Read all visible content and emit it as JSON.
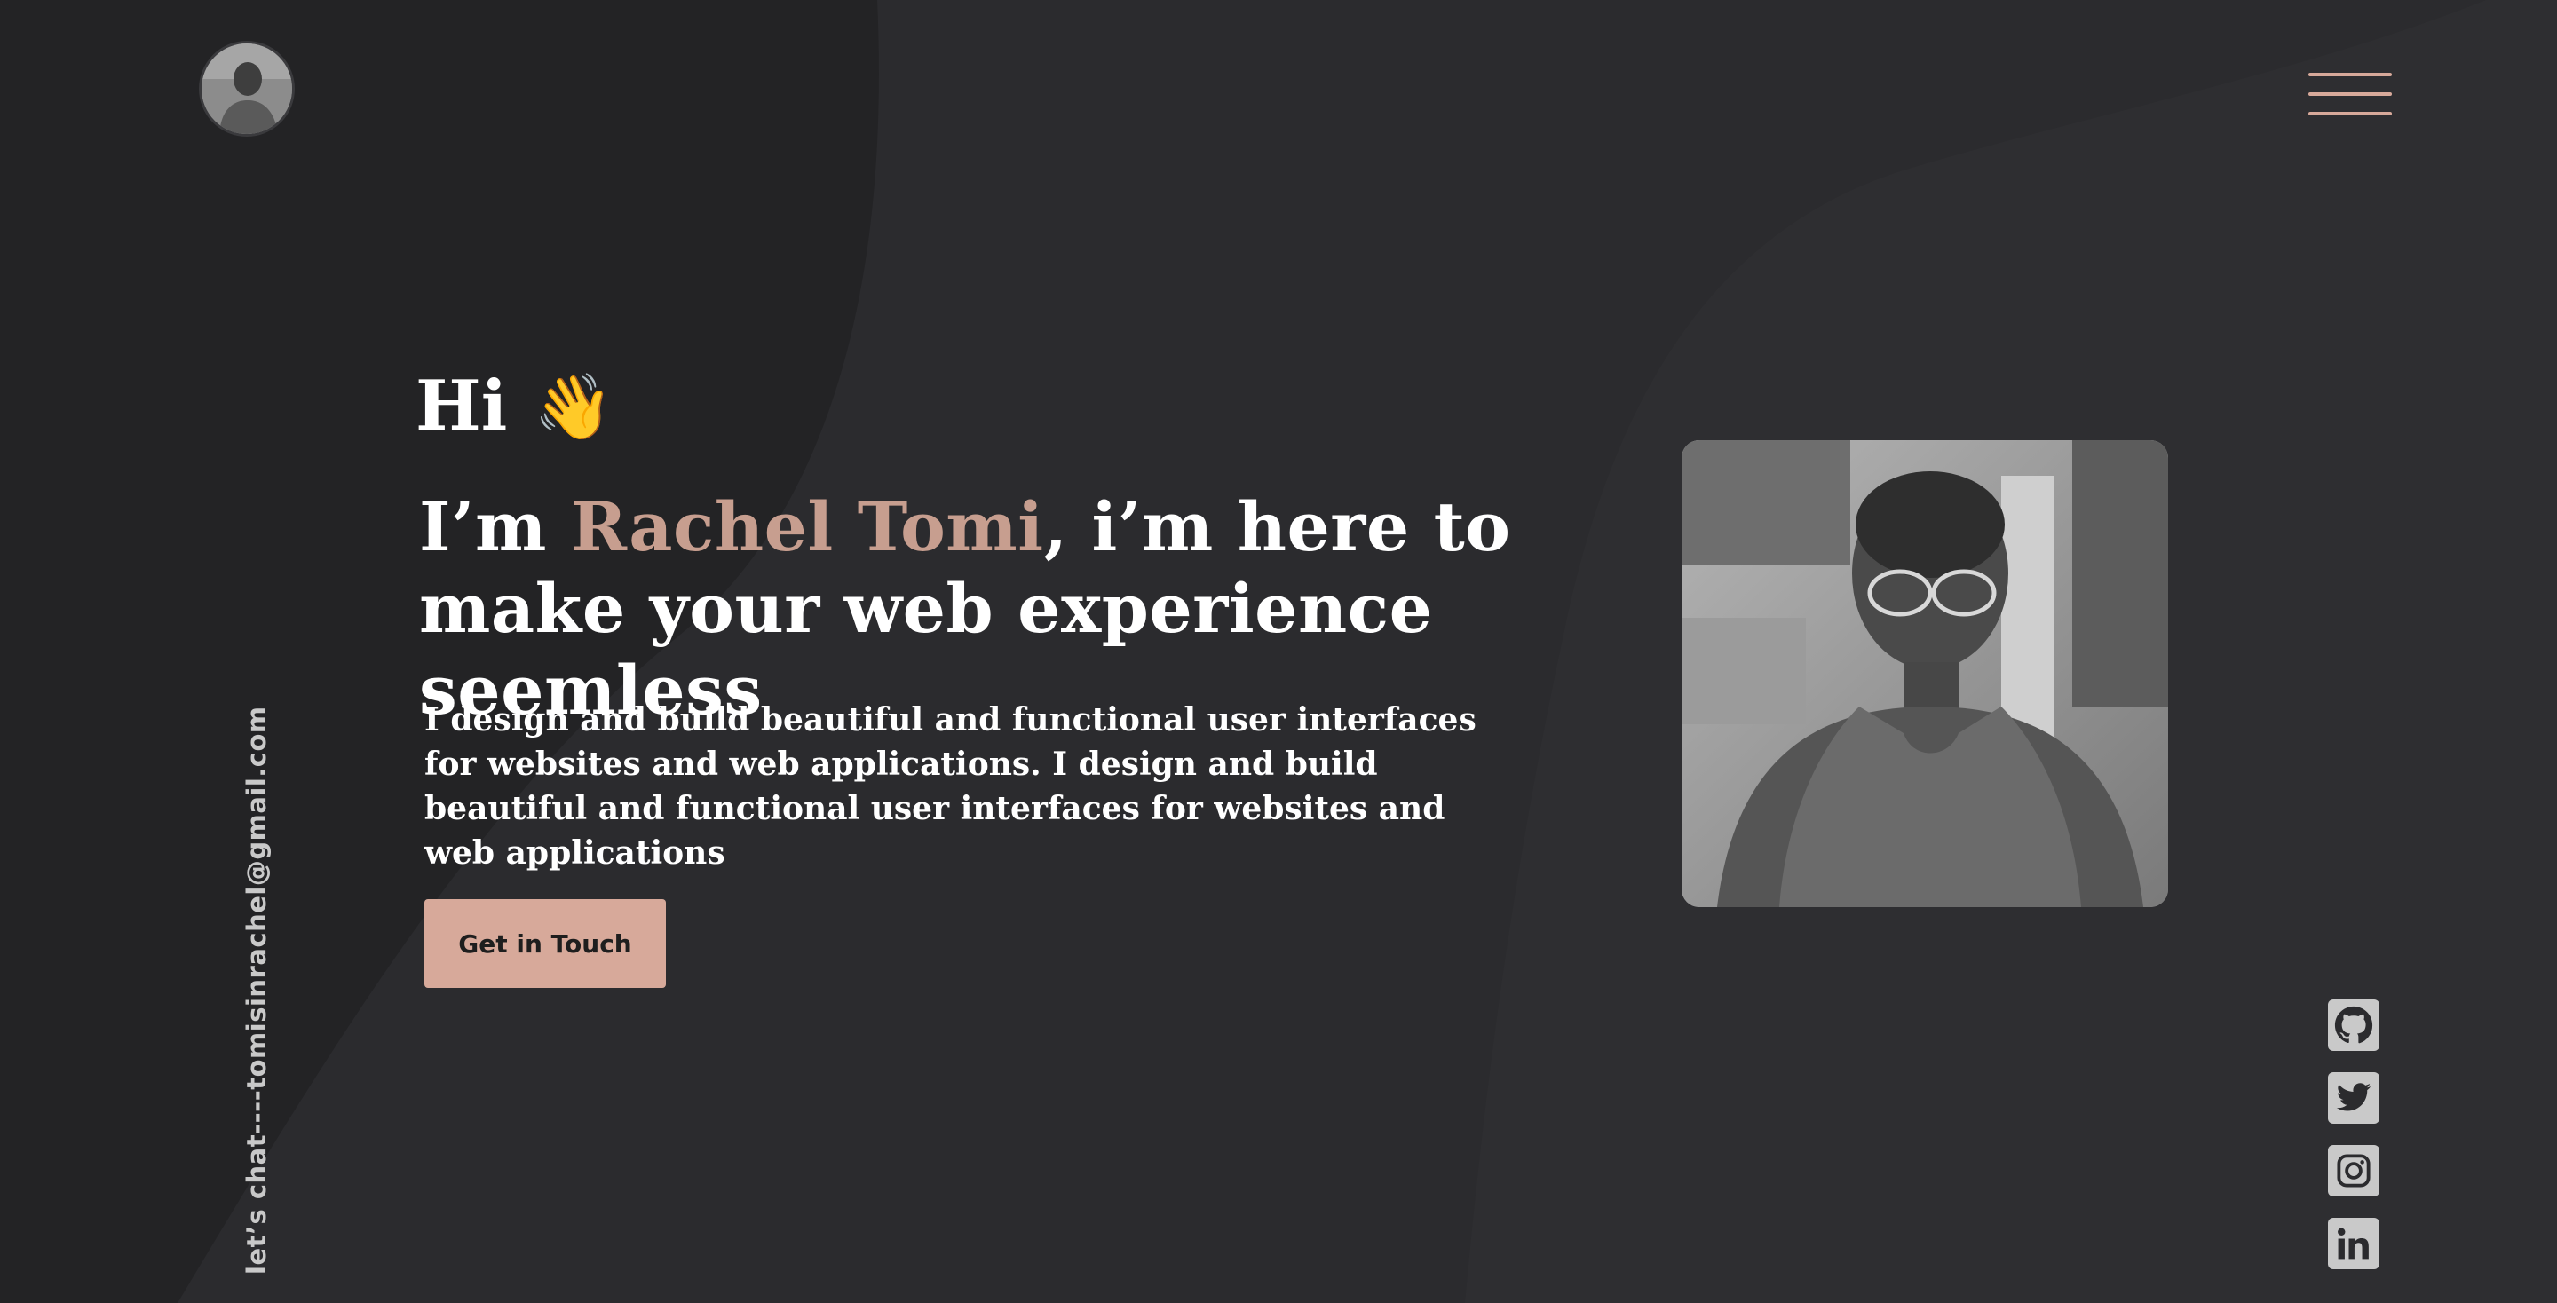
{
  "header": {
    "avatar_alt": "Rachel Tomi avatar",
    "menu_icon": "hamburger-menu-icon"
  },
  "hero": {
    "greeting": "Hi",
    "wave_emoji": "👋",
    "headline_prefix": "I’m ",
    "headline_name": "Rachel Tomi",
    "headline_suffix": ", i’m here to make your web experience seemless",
    "description": "I design and build beautiful and functional user interfaces for websites and web applications. I design and build beautiful and functional user interfaces for websites and web applications",
    "cta_label": "Get in Touch"
  },
  "sidebar": {
    "email_text": "let’s chat----tomisinrachel@gmail.com"
  },
  "socials": [
    {
      "name": "github-icon"
    },
    {
      "name": "twitter-icon"
    },
    {
      "name": "instagram-icon"
    },
    {
      "name": "linkedin-icon"
    }
  ],
  "colors": {
    "background": "#2b2b2e",
    "background_dark": "#222224",
    "accent": "#d7a99a",
    "name_accent": "#c79e8f",
    "icon_bg": "#c9c9c9"
  }
}
